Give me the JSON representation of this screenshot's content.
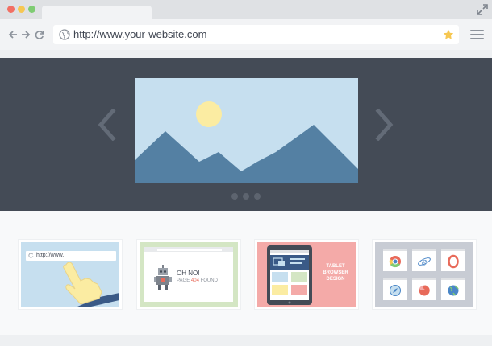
{
  "window": {
    "controls": [
      "close",
      "minimize",
      "maximize"
    ],
    "expand_icon": "expand-arrows-icon"
  },
  "toolbar": {
    "back_icon": "arrow-left-icon",
    "forward_icon": "arrow-right-icon",
    "reload_icon": "reload-icon",
    "url": "http://www.your-website.com",
    "bookmark_icon": "star-icon",
    "menu_icon": "hamburger-menu-icon"
  },
  "slider": {
    "prev_icon": "chevron-left-icon",
    "next_icon": "chevron-right-icon",
    "image": "landscape-mountains-sun",
    "pagination_count": 3
  },
  "cards": [
    {
      "name": "url-typing",
      "url_text": "http://www."
    },
    {
      "name": "page-not-found",
      "line1": "OH NO!",
      "line2_prefix": "PAGE ",
      "line2_code": "404",
      "line2_suffix": " FOUND"
    },
    {
      "name": "tablet-design",
      "caption_lines": [
        "TABLET",
        "BROWSER",
        "DESIGN"
      ]
    },
    {
      "name": "browser-icons",
      "icons": [
        "chrome-icon",
        "ie-icon",
        "opera-icon",
        "safari-icon",
        "firefox-icon",
        "globe-icon"
      ]
    }
  ],
  "colors": {
    "hero_bg": "#444b56",
    "sky": "#c6dfef",
    "mountain": "#5480a3",
    "sun": "#fbeca2",
    "accent_404": "#e86a5a",
    "tablet_card_bg": "#f4aaa8"
  }
}
